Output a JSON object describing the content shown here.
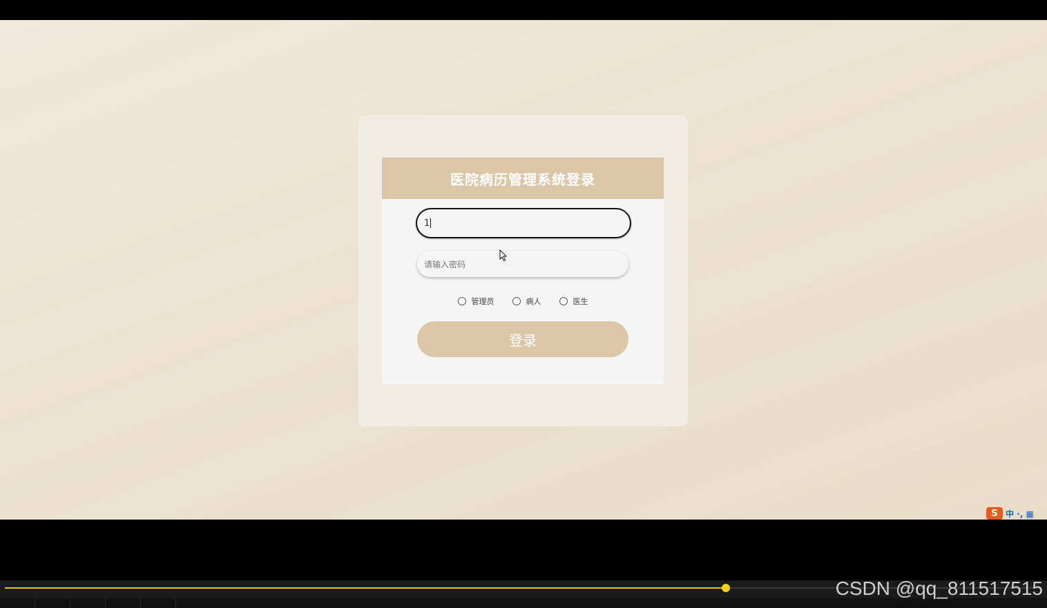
{
  "login": {
    "title": "医院病历管理系统登录",
    "username_value": "1",
    "password_placeholder": "请输入密码",
    "roles": [
      {
        "label": "管理员"
      },
      {
        "label": "病人"
      },
      {
        "label": "医生"
      }
    ],
    "submit_label": "登录"
  },
  "ime": {
    "logo": "S",
    "text": "中 ·, ▦"
  },
  "player": {
    "progress": 0.696
  },
  "watermark": "CSDN @qq_811517515",
  "colors": {
    "header": "#dcc6a8",
    "button": "#dcc6a8",
    "background": "#ece2d0",
    "progress": "#e8c21a"
  }
}
